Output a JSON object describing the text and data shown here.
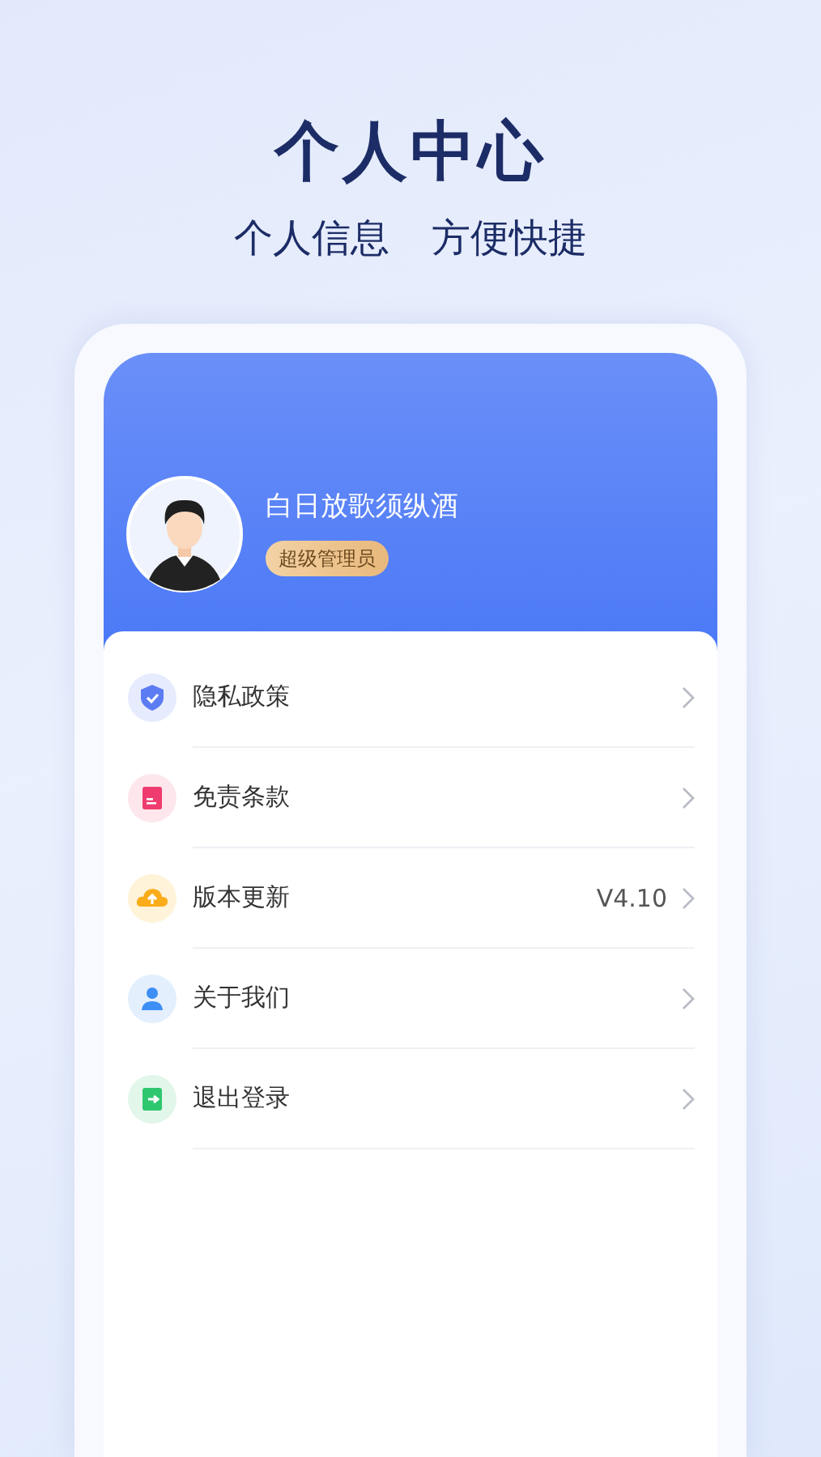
{
  "headline": {
    "title": "个人中心",
    "subtitle": [
      "个人信息",
      "方便快捷"
    ]
  },
  "profile": {
    "name": "白日放歌须纵酒",
    "role": "超级管理员"
  },
  "menu": [
    {
      "label": "隐私政策"
    },
    {
      "label": "免责条款"
    },
    {
      "label": "版本更新",
      "value": "V4.10"
    },
    {
      "label": "关于我们"
    },
    {
      "label": "退出登录"
    }
  ]
}
